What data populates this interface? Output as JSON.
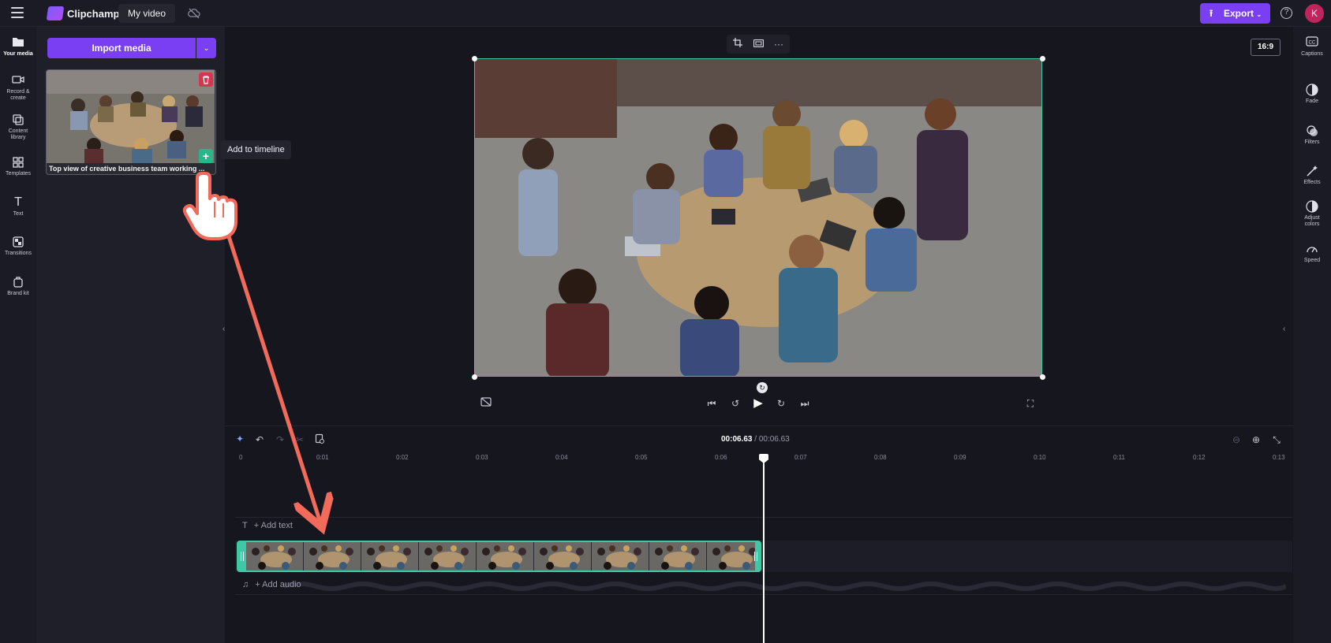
{
  "topbar": {
    "brand": "Clipchamp",
    "video_name": "My video",
    "export_label": "Export",
    "avatar_initial": "K",
    "help_glyph": "?",
    "export_icon": "upload-icon",
    "cloud_icon": "cloud-off-icon"
  },
  "leftnav": {
    "items": [
      {
        "label": "Your media",
        "icon": "folder-icon"
      },
      {
        "label": "Record & create",
        "icon": "camera-icon"
      },
      {
        "label": "Content library",
        "icon": "library-icon"
      },
      {
        "label": "Templates",
        "icon": "templates-icon"
      },
      {
        "label": "Text",
        "icon": "text-icon"
      },
      {
        "label": "Transitions",
        "icon": "transitions-icon"
      },
      {
        "label": "Brand kit",
        "icon": "brand-kit-icon"
      }
    ]
  },
  "media_panel": {
    "import_label": "Import media",
    "card_title": "Top view of creative business team working ...",
    "tooltip": "Add to timeline"
  },
  "preview": {
    "aspect_ratio": "16:9"
  },
  "rightnav": {
    "items": [
      {
        "label": "Captions",
        "icon": "captions-icon"
      },
      {
        "label": "Fade",
        "icon": "fade-icon"
      },
      {
        "label": "Filters",
        "icon": "filters-icon"
      },
      {
        "label": "Effects",
        "icon": "effects-icon"
      },
      {
        "label": "Adjust colors",
        "icon": "adjust-colors-icon"
      },
      {
        "label": "Speed",
        "icon": "speed-icon"
      }
    ]
  },
  "timeline": {
    "current_time": "00:06.63",
    "total_time": "/ 00:06.63",
    "ruler": [
      "0",
      "0:01",
      "0:02",
      "0:03",
      "0:04",
      "0:05",
      "0:06",
      "0:07",
      "0:08",
      "0:09",
      "0:10",
      "0:11",
      "0:12",
      "0:13"
    ],
    "add_text": "+ Add text",
    "add_audio": "+ Add audio",
    "text_track_glyph": "T",
    "audio_track_glyph": "♫"
  },
  "colors": {
    "accent": "#7a3ff2",
    "selection": "#3fc7a6",
    "delete": "#d4364e",
    "avatar": "#c0245c",
    "annotation_arrow": "#f26a5a"
  }
}
